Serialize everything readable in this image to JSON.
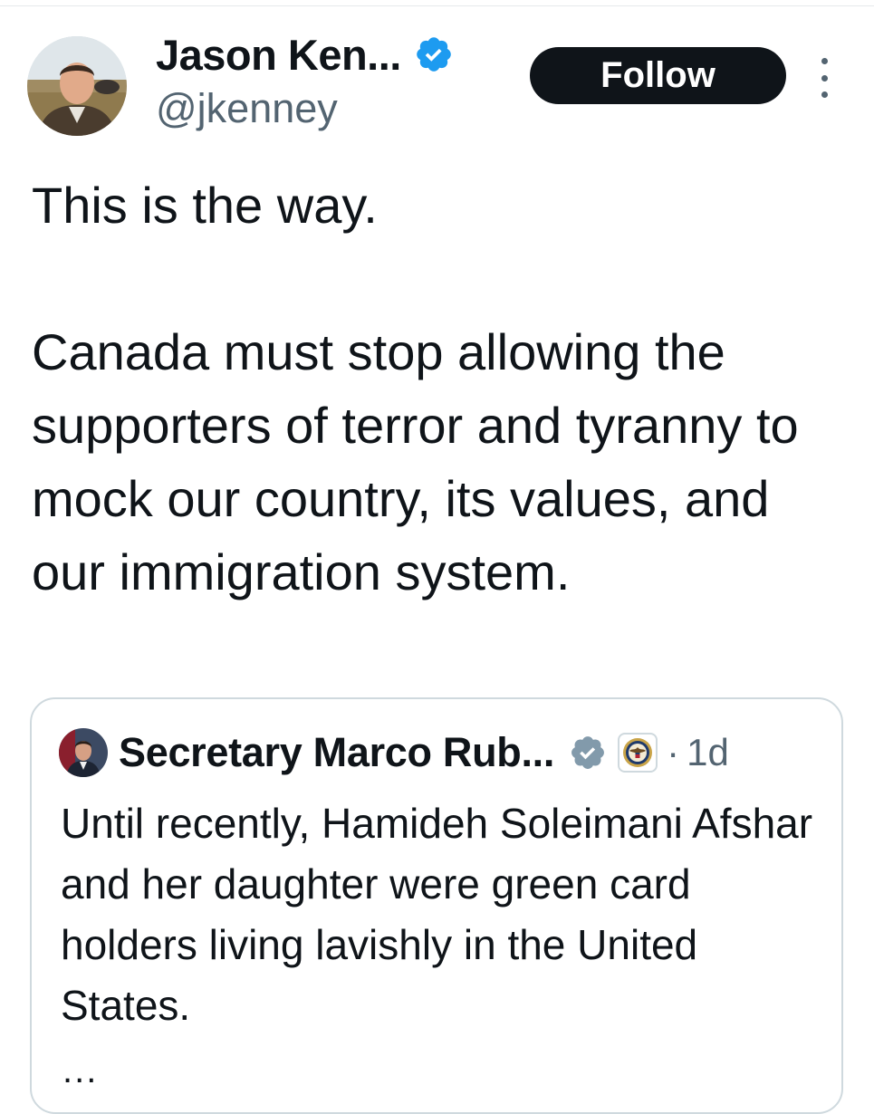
{
  "tweet": {
    "author": {
      "name": "Jason Ken...",
      "handle": "@jkenney",
      "verified": true
    },
    "follow_label": "Follow",
    "text": "This is the way.\n\nCanada must stop allowing the supporters of terror and tyranny to mock our country, its values, and our immigration system."
  },
  "quote": {
    "author": {
      "name": "Secretary Marco Rub...",
      "verified": true,
      "affiliation_icon": "state-department-seal-icon"
    },
    "separator": "·",
    "time": "1d",
    "text": "Until recently, Hamideh Soleimani Afshar and her daughter were green card holders living lavishly in the United States.",
    "ellipsis": "..."
  },
  "colors": {
    "primary_text": "#0f1419",
    "secondary_text": "#536471",
    "verified_blue": "#1d9bf0",
    "verified_gray": "#829aab",
    "border": "#cfd9de",
    "follow_bg": "#0f1419"
  }
}
